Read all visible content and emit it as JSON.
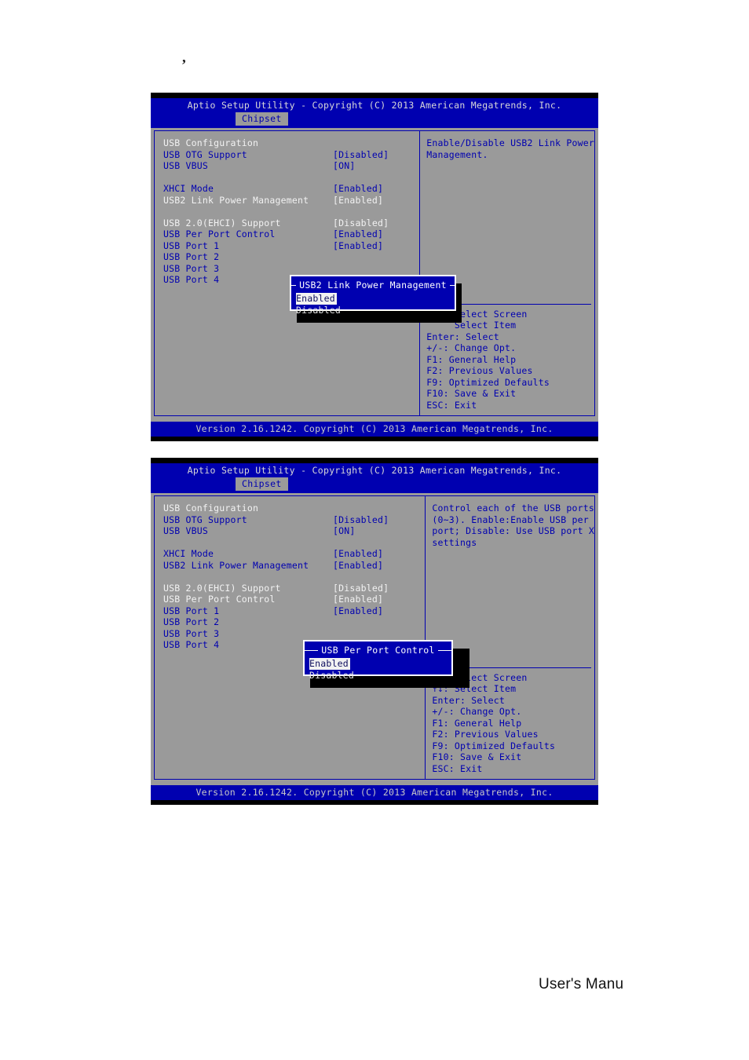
{
  "page": {
    "tick_mark": ",",
    "footer_text": "User's Manu"
  },
  "colors": {
    "bios_blue": "#0000b0",
    "bios_gray": "#9a9a9a",
    "bios_black": "#000000",
    "selected_white": "#f2f2f2",
    "title_text": "#d8d8d8"
  },
  "screens": [
    {
      "id": "screen-usb2-link-power-management",
      "titlebar": "Aptio Setup Utility - Copyright (C) 2013 American Megatrends, Inc.",
      "tab": "Chipset",
      "items": [
        {
          "label": "USB Configuration",
          "value": "",
          "label_color": "white",
          "value_color": "white"
        },
        {
          "label": "USB OTG Support",
          "value": "[Disabled]",
          "label_color": "blue",
          "value_color": "blue"
        },
        {
          "label": "USB VBUS",
          "value": "[ON]",
          "label_color": "blue",
          "value_color": "blue"
        },
        {
          "label": "",
          "value": "",
          "label_color": "blue",
          "value_color": "blue"
        },
        {
          "label": "XHCI Mode",
          "value": "[Enabled]",
          "label_color": "blue",
          "value_color": "blue"
        },
        {
          "label": "USB2 Link Power Management",
          "value": "[Enabled]",
          "label_color": "white",
          "value_color": "white"
        },
        {
          "label": "",
          "value": "",
          "label_color": "blue",
          "value_color": "blue"
        },
        {
          "label": "USB 2.0(EHCI) Support",
          "value": "[Disabled]",
          "label_color": "white",
          "value_color": "white"
        },
        {
          "label": "USB Per Port Control",
          "value": "[Enabled]",
          "label_color": "blue",
          "value_color": "blue"
        },
        {
          "label": "USB Port 1",
          "value": "[Enabled]",
          "label_color": "blue",
          "value_color": "blue"
        },
        {
          "label": "USB Port 2",
          "value": "",
          "label_color": "blue",
          "value_color": "blue"
        },
        {
          "label": "USB Port 3",
          "value": "",
          "label_color": "blue",
          "value_color": "blue"
        },
        {
          "label": "USB Port 4",
          "value": "",
          "label_color": "blue",
          "value_color": "blue"
        }
      ],
      "help": [
        "Enable/Disable USB2 Link Power",
        "Management."
      ],
      "keys": [
        {
          "combo": "",
          "action": "Select Screen",
          "arrows": ""
        },
        {
          "combo": "",
          "action": "Select Item",
          "arrows": ""
        },
        {
          "combo": "Enter",
          "action": "Select",
          "arrows": ""
        },
        {
          "combo": "+/-",
          "action": "Change Opt.",
          "arrows": ""
        },
        {
          "combo": "F1",
          "action": "General Help",
          "arrows": ""
        },
        {
          "combo": "F2",
          "action": "Previous Values",
          "arrows": ""
        },
        {
          "combo": "F9",
          "action": "Optimized Defaults",
          "arrows": ""
        },
        {
          "combo": "F10",
          "action": "Save & Exit",
          "arrows": ""
        },
        {
          "combo": "ESC",
          "action": "Exit",
          "arrows": ""
        }
      ],
      "popup": {
        "title": "USB2 Link Power Management",
        "options": [
          {
            "label": "Enabled",
            "selected": true
          },
          {
            "label": "Disabled",
            "selected": false
          }
        ]
      },
      "footer": "Version 2.16.1242. Copyright (C) 2013 American Megatrends, Inc."
    },
    {
      "id": "screen-usb-per-port-control",
      "titlebar": "Aptio Setup Utility - Copyright (C) 2013 American Megatrends, Inc.",
      "tab": "Chipset",
      "items": [
        {
          "label": "USB Configuration",
          "value": "",
          "label_color": "white",
          "value_color": "white"
        },
        {
          "label": "USB OTG Support",
          "value": "[Disabled]",
          "label_color": "blue",
          "value_color": "blue"
        },
        {
          "label": "USB VBUS",
          "value": "[ON]",
          "label_color": "blue",
          "value_color": "blue"
        },
        {
          "label": "",
          "value": "",
          "label_color": "blue",
          "value_color": "blue"
        },
        {
          "label": "XHCI Mode",
          "value": "[Enabled]",
          "label_color": "blue",
          "value_color": "blue"
        },
        {
          "label": "USB2 Link Power Management",
          "value": "[Enabled]",
          "label_color": "blue",
          "value_color": "blue"
        },
        {
          "label": "",
          "value": "",
          "label_color": "blue",
          "value_color": "blue"
        },
        {
          "label": "USB 2.0(EHCI) Support",
          "value": "[Disabled]",
          "label_color": "white",
          "value_color": "white"
        },
        {
          "label": "USB Per Port Control",
          "value": "[Enabled]",
          "label_color": "white",
          "value_color": "white"
        },
        {
          "label": "USB Port 1",
          "value": "[Enabled]",
          "label_color": "blue",
          "value_color": "blue"
        },
        {
          "label": "USB Port 2",
          "value": "",
          "label_color": "blue",
          "value_color": "blue"
        },
        {
          "label": "USB Port 3",
          "value": "",
          "label_color": "blue",
          "value_color": "blue"
        },
        {
          "label": "USB Port 4",
          "value": "",
          "label_color": "blue",
          "value_color": "blue"
        }
      ],
      "help": [
        "Control each of the USB ports",
        "(0~3). Enable:Enable USB per",
        "port; Disable: Use USB port X",
        "settings"
      ],
      "keys": [
        {
          "combo": "",
          "action": "Select Screen",
          "arrows": "><"
        },
        {
          "combo": "",
          "action": "Select Item",
          "arrows": "↑↓"
        },
        {
          "combo": "Enter",
          "action": "Select",
          "arrows": ""
        },
        {
          "combo": "+/-",
          "action": "Change Opt.",
          "arrows": ""
        },
        {
          "combo": "F1",
          "action": "General Help",
          "arrows": ""
        },
        {
          "combo": "F2",
          "action": "Previous Values",
          "arrows": ""
        },
        {
          "combo": "F9",
          "action": "Optimized Defaults",
          "arrows": ""
        },
        {
          "combo": "F10",
          "action": "Save & Exit",
          "arrows": ""
        },
        {
          "combo": "ESC",
          "action": "Exit",
          "arrows": ""
        }
      ],
      "popup": {
        "title": "USB Per Port Control",
        "options": [
          {
            "label": "Enabled",
            "selected": true
          },
          {
            "label": "Disabled",
            "selected": false
          }
        ]
      },
      "footer": "Version 2.16.1242. Copyright (C) 2013 American Megatrends, Inc."
    }
  ]
}
